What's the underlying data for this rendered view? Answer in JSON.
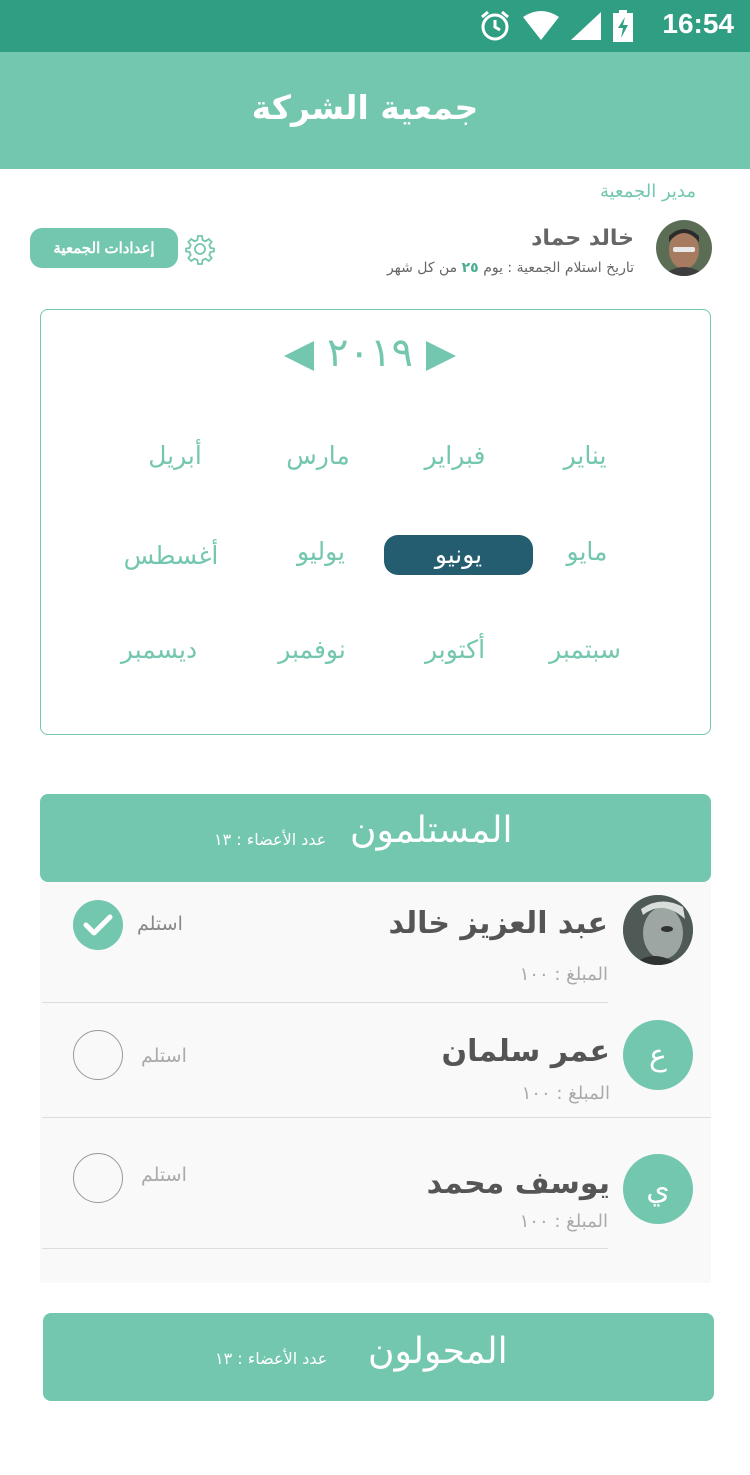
{
  "status_bar": {
    "time": "16:54"
  },
  "app_bar": {
    "title": "جمعية الشركة"
  },
  "manager": {
    "section_label": "مدير الجمعية",
    "name": "خالد حماد",
    "subtitle_prefix": "تاريخ استلام الجمعية : يوم",
    "subtitle_day": "٢٥",
    "subtitle_suffix": "من كل شهر",
    "settings_label": "إعدادات الجمعية"
  },
  "calendar": {
    "year": "٢٠١٩",
    "months": [
      "يناير",
      "فبراير",
      "مارس",
      "أبريل",
      "مايو",
      "يونيو",
      "يوليو",
      "أغسطس",
      "سبتمبر",
      "أكتوبر",
      "نوفمبر",
      "ديسمبر"
    ],
    "selected": "يونيو"
  },
  "receivers": {
    "title": "المستلمون",
    "count_text": "عدد الأعضاء : ١٣",
    "members": [
      {
        "name": "عبد العزيز خالد",
        "amount": "المبلغ : ١٠٠",
        "initial": "",
        "receive_label": "استلم",
        "received": true
      },
      {
        "name": "عمر سلمان",
        "amount": "المبلغ : ١٠٠",
        "initial": "ع",
        "receive_label": "استلم",
        "received": false
      },
      {
        "name": "يوسف محمد",
        "amount": "المبلغ : ١٠٠",
        "initial": "ي",
        "receive_label": "استلم",
        "received": false
      }
    ]
  },
  "transferers": {
    "title": "المحولون",
    "count_text": "عدد الأعضاء : ١٣"
  },
  "colors": {
    "status_bar": "#2f9e82",
    "primary": "#74c7af",
    "selected_month": "#245d70"
  }
}
